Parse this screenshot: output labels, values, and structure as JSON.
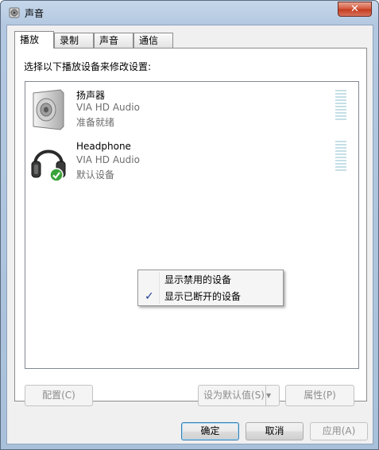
{
  "window": {
    "title": "声音",
    "close_label": "✕"
  },
  "tabs": [
    {
      "label": "播放",
      "active": true
    },
    {
      "label": "录制",
      "active": false
    },
    {
      "label": "声音",
      "active": false
    },
    {
      "label": "通信",
      "active": false
    }
  ],
  "instruction": "选择以下播放设备来修改设置:",
  "devices": [
    {
      "name": "扬声器",
      "driver": "VIA HD Audio",
      "status": "准备就绪",
      "icon": "speaker-icon"
    },
    {
      "name": "Headphone",
      "driver": "VIA HD Audio",
      "status": "默认设备",
      "icon": "headphone-icon",
      "is_default": true
    }
  ],
  "context_menu": {
    "items": [
      {
        "label": "显示禁用的设备",
        "checked": false
      },
      {
        "label": "显示已断开的设备",
        "checked": true
      }
    ],
    "check_glyph": "✓"
  },
  "panel_buttons": {
    "configure": "配置(C)",
    "set_default": "设为默认值(S)",
    "properties": "属性(P)",
    "dropdown_glyph": "▼"
  },
  "dialog_buttons": {
    "ok": "确定",
    "cancel": "取消",
    "apply": "应用(A)"
  }
}
